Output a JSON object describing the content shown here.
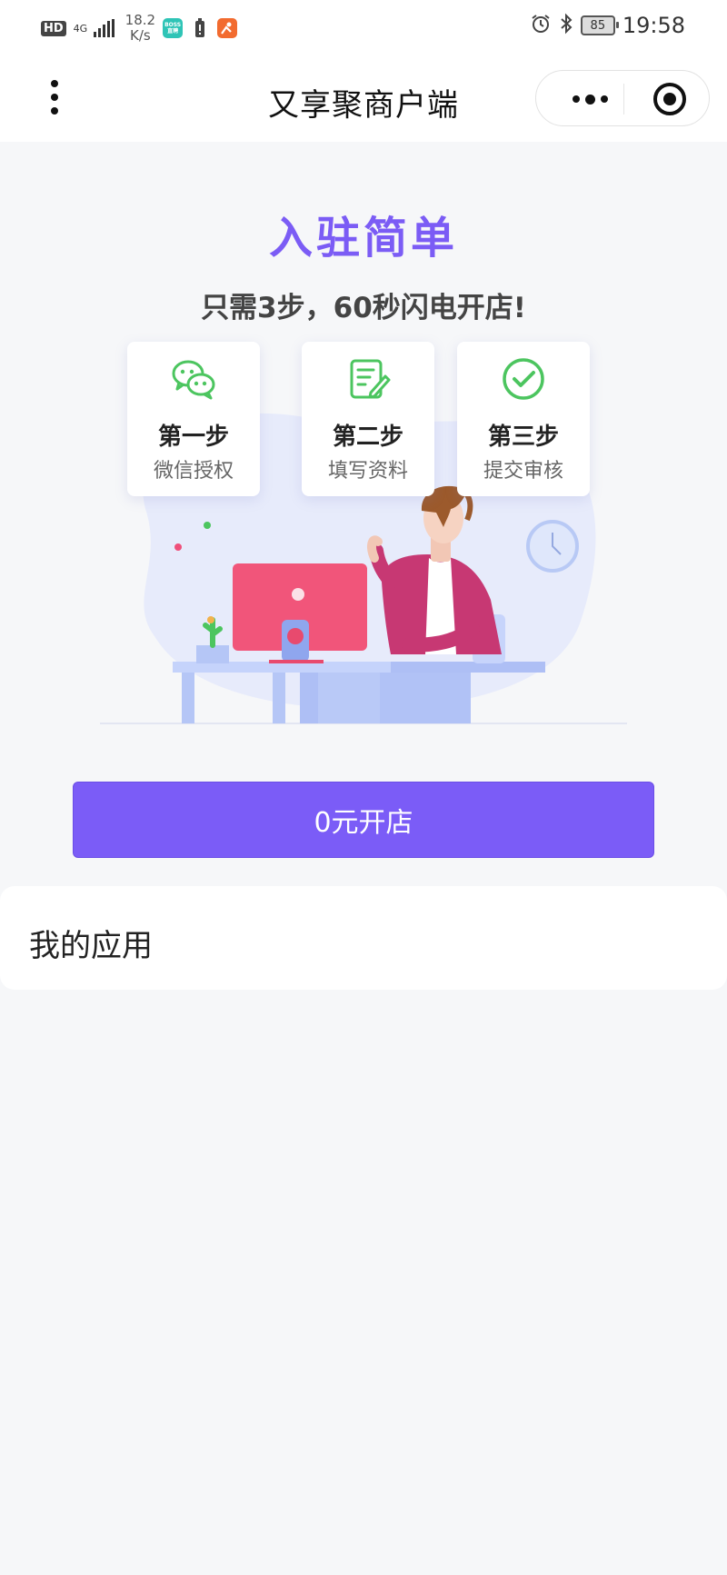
{
  "status_bar": {
    "hd": "HD",
    "network": "4G",
    "net_speed_value": "18.2",
    "net_speed_unit": "K/s",
    "boss_app_label": "BOSS直聘",
    "battery": "85",
    "time": "19:58"
  },
  "title_bar": {
    "title": "又享聚商户端"
  },
  "hero": {
    "title": "入驻简单",
    "subtitle": "只需3步，60秒闪电开店!"
  },
  "steps": [
    {
      "label": "第一步",
      "desc": "微信授权",
      "icon": "wechat-icon"
    },
    {
      "label": "第二步",
      "desc": "填写资料",
      "icon": "edit-form-icon"
    },
    {
      "label": "第三步",
      "desc": "提交审核",
      "icon": "check-circle-icon"
    }
  ],
  "open_store_button": "0元开店",
  "my_apps": {
    "title": "我的应用"
  },
  "colors": {
    "accent": "#7b5cf7",
    "step_icon": "#4cc55f",
    "background": "#f6f7f9"
  }
}
